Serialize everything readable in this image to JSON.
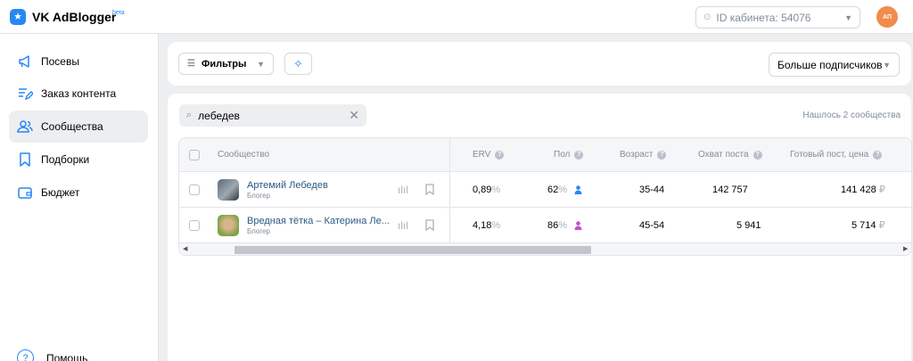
{
  "header": {
    "brand": "VK AdBlogger",
    "beta": "beta",
    "cabinet_placeholder": "ID кабинета: 54076",
    "avatar_initials": "АП"
  },
  "sidebar": {
    "items": [
      {
        "label": "Посевы",
        "icon": "megaphone-icon"
      },
      {
        "label": "Заказ контента",
        "icon": "edit-list-icon"
      },
      {
        "label": "Сообщества",
        "icon": "users-icon"
      },
      {
        "label": "Подборки",
        "icon": "bookmark-icon"
      },
      {
        "label": "Бюджет",
        "icon": "wallet-icon"
      }
    ],
    "help": "Помощь"
  },
  "filters": {
    "filters_label": "Фильтры",
    "sort_label": "Больше подписчиков"
  },
  "search": {
    "value": "лебедев",
    "found": "Нашлось 2 сообщества"
  },
  "table": {
    "headers": {
      "community": "Сообщество",
      "erv": "ERV",
      "gender": "Пол",
      "age": "Возраст",
      "reach": "Охват поста",
      "price": "Готовый пост, цена"
    },
    "rows": [
      {
        "name": "Артемий Лебедев",
        "type": "Блогер",
        "erv": "0,89",
        "gender": "62",
        "age": "35-44",
        "reach": "142 757",
        "price": "141 428",
        "gender_color": "#2787f5"
      },
      {
        "name": "Вредная тётка – Катерина Ле...",
        "type": "Блогер",
        "erv": "4,18",
        "gender": "86",
        "age": "45-54",
        "reach": "5 941",
        "price": "5 714",
        "gender_color": "#c24fcb"
      }
    ],
    "percent": "%",
    "currency": "₽"
  }
}
